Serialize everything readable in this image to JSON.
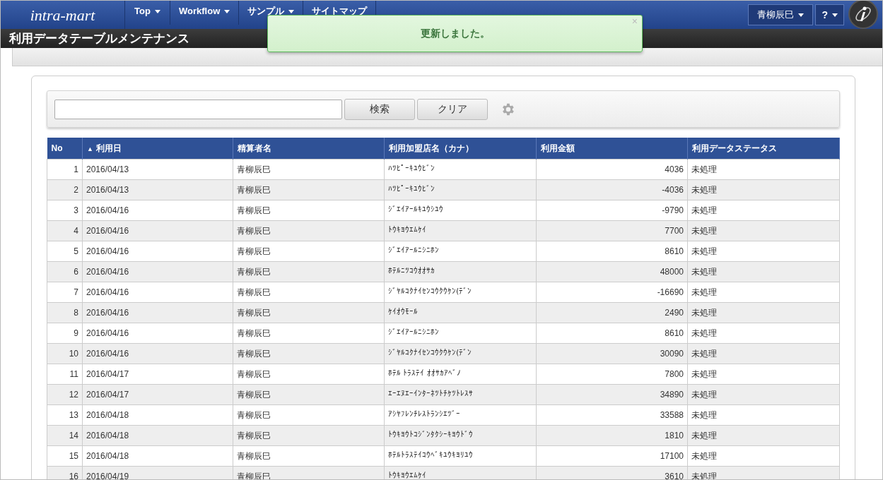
{
  "header": {
    "logo": "intra-mart",
    "menu": [
      {
        "label": "Top",
        "dropdown": true
      },
      {
        "label": "Workflow",
        "dropdown": true
      },
      {
        "label": "サンプル",
        "dropdown": true
      },
      {
        "label": "サイトマップ",
        "dropdown": false
      }
    ],
    "user": "青柳辰巳",
    "help": "?"
  },
  "page_title": "利用データテーブルメンテナンス",
  "toast": {
    "message": "更新しました。",
    "close": "×"
  },
  "search": {
    "buttons": [
      "検索",
      "クリア"
    ]
  },
  "table": {
    "columns": [
      {
        "label": "No"
      },
      {
        "label": "利用日",
        "sort_icon": "▲"
      },
      {
        "label": "精算者名"
      },
      {
        "label": "利用加盟店名（カナ）"
      },
      {
        "label": "利用金額"
      },
      {
        "label": "利用データステータス"
      }
    ],
    "rows": [
      [
        "1",
        "2016/04/13",
        "青柳辰巳",
        "ﾊﾂﾋﾟｰｷﾕｳﾋﾞﾝ",
        "4036",
        "未処理"
      ],
      [
        "2",
        "2016/04/13",
        "青柳辰巳",
        "ﾊﾂﾋﾟｰｷﾕｳﾋﾞﾝ",
        "-4036",
        "未処理"
      ],
      [
        "3",
        "2016/04/16",
        "青柳辰巳",
        "ｼﾞｴｲｱｰﾙｷﾕｳｼﾕｳ",
        "-9790",
        "未処理"
      ],
      [
        "4",
        "2016/04/16",
        "青柳辰巳",
        "ﾄｳｷﾖｳｴﾑｹｲ",
        "7700",
        "未処理"
      ],
      [
        "5",
        "2016/04/16",
        "青柳辰巳",
        "ｼﾞｴｲｱｰﾙﾆｼﾆﾎﾝ",
        "8610",
        "未処理"
      ],
      [
        "6",
        "2016/04/16",
        "青柳辰巳",
        "ﾎﾃﾙﾆﾂｺｳｵｵｻｶ",
        "48000",
        "未処理"
      ],
      [
        "7",
        "2016/04/16",
        "青柳辰巳",
        "ｼﾞﾔﾙｺｸﾅｲｾﾝｺｳｸｳｹﾝ(ﾃﾞﾝ",
        "-16690",
        "未処理"
      ],
      [
        "8",
        "2016/04/16",
        "青柳辰巳",
        "ｹｲｵｳﾓｰﾙ",
        "2490",
        "未処理"
      ],
      [
        "9",
        "2016/04/16",
        "青柳辰巳",
        "ｼﾞｴｲｱｰﾙﾆｼﾆﾎﾝ",
        "8610",
        "未処理"
      ],
      [
        "10",
        "2016/04/16",
        "青柳辰巳",
        "ｼﾞﾔﾙｺｸﾅｲｾﾝｺｳｸｳｹﾝ(ﾃﾞﾝ",
        "30090",
        "未処理"
      ],
      [
        "11",
        "2016/04/17",
        "青柳辰巳",
        "ﾎﾃﾙ ﾄﾗｽﾃｲ ｵｵｻｶｱﾍﾞﾉ",
        "7800",
        "未処理"
      ],
      [
        "12",
        "2016/04/17",
        "青柳辰巳",
        "ｴｰｴﾇｴｰｲﾝﾀｰﾈﾂﾄﾁｹﾂﾄﾚｽｻ",
        "34890",
        "未処理"
      ],
      [
        "13",
        "2016/04/18",
        "青柳辰巳",
        "ｱｼﾔﾌﾚﾝﾁﾚｽﾄﾗﾝｼｴﾂﾞｰ",
        "33588",
        "未処理"
      ],
      [
        "14",
        "2016/04/18",
        "青柳辰巳",
        "ﾄｳｷﾖｳﾄｺｼﾞﾝﾀｸｼｰｷﾖｳﾄﾞｳ",
        "1810",
        "未処理"
      ],
      [
        "15",
        "2016/04/18",
        "青柳辰巳",
        "ﾎﾃﾙﾄﾗｽﾃｲｺｳﾍﾞｷﾕｳｷﾖﾘﾕｳ",
        "17100",
        "未処理"
      ],
      [
        "16",
        "2016/04/19",
        "青柳辰巳",
        "ﾄｳｷﾖｳｴﾑｹｲ",
        "3610",
        "未処理"
      ]
    ]
  }
}
